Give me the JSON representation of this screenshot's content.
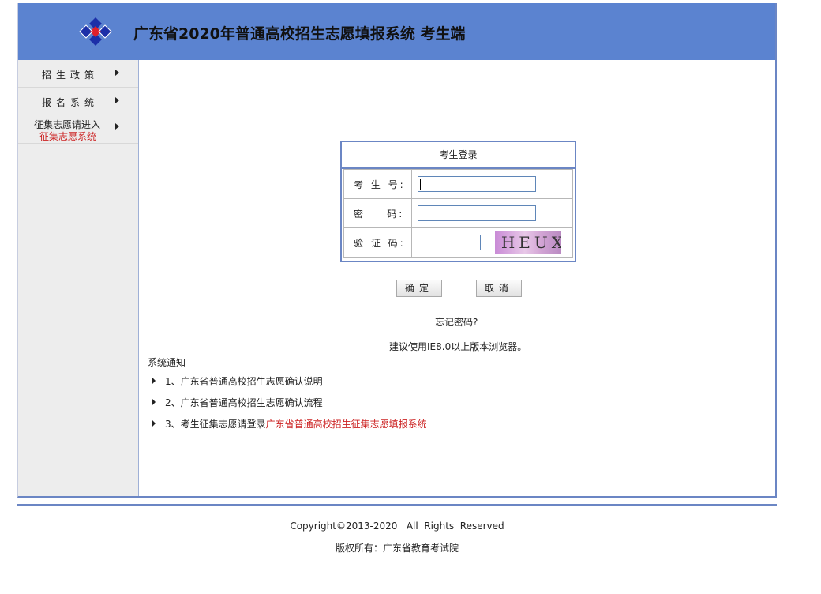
{
  "header": {
    "title": "广东省2020年普通高校招生志愿填报系统 考生端",
    "logo_icon": "diamond-cluster-logo-icon"
  },
  "sidebar": {
    "items": [
      {
        "label": "招生政策"
      },
      {
        "label": "报名系统"
      },
      {
        "label_line1": "征集志愿请进入",
        "label_line2": "征集志愿系统"
      }
    ]
  },
  "login": {
    "title": "考生登录",
    "fields": [
      {
        "label": "考 生 号:",
        "value": ""
      },
      {
        "label": "密    码:",
        "value": ""
      },
      {
        "label": "验 证 码:",
        "value": ""
      }
    ],
    "captcha_text": "HEUX",
    "confirm_label": "确定",
    "cancel_label": "取消",
    "forgot_label": "忘记密码?",
    "browser_tip": "建议使用IE8.0以上版本浏览器。"
  },
  "notices": {
    "title": "系统通知",
    "items": [
      {
        "text": "1、广东省普通高校招生志愿确认说明",
        "link": ""
      },
      {
        "text": "2、广东省普通高校招生志愿确认流程",
        "link": ""
      },
      {
        "text": "3、考生征集志愿请登录",
        "link": "广东省普通高校招生征集志愿填报系统"
      }
    ]
  },
  "footer": {
    "copyright": "Copyright©2013-2020   All  Rights  Reserved",
    "owner": "版权所有：广东省教育考试院"
  },
  "colors": {
    "header_bg": "#5b83d0",
    "border_blue": "#6b86c4",
    "link_red": "#cc2222",
    "sidebar_bg": "#ededed"
  }
}
